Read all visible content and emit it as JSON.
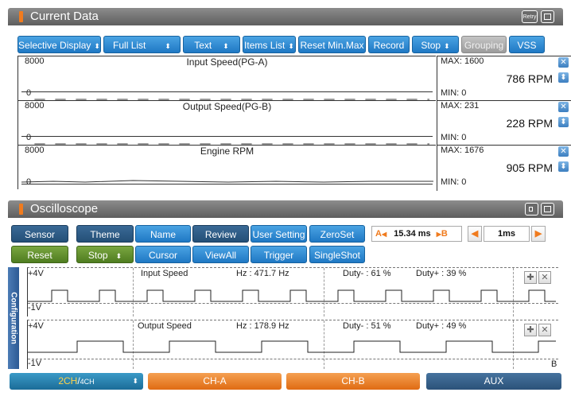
{
  "current_data": {
    "title": "Current Data",
    "retry_label": "Retry",
    "toolbar": {
      "selective_display": "Selective Display",
      "full_list": "Full List",
      "text": "Text",
      "items_list": "Items List",
      "reset_min_max": "Reset Min.Max",
      "record": "Record",
      "stop": "Stop",
      "grouping": "Grouping",
      "vss": "VSS"
    },
    "graphs": [
      {
        "title": "Input Speed(PG-A)",
        "ymax": "8000",
        "ymin": "0",
        "max": "MAX: 1600",
        "min": "MIN: 0",
        "value": "786 RPM"
      },
      {
        "title": "Output Speed(PG-B)",
        "ymax": "8000",
        "ymin": "0",
        "max": "MAX: 231",
        "min": "MIN: 0",
        "value": "228 RPM"
      },
      {
        "title": "Engine RPM",
        "ymax": "8000",
        "ymin": "0",
        "max": "MAX: 1676",
        "min": "MIN: 0",
        "value": "905 RPM"
      }
    ]
  },
  "oscilloscope": {
    "title": "Oscilloscope",
    "row1": {
      "sensor": "Sensor",
      "theme": "Theme",
      "name": "Name",
      "review": "Review",
      "user_setting": "User Setting",
      "zeroset": "ZeroSet"
    },
    "row2": {
      "reset": "Reset",
      "stop": "Stop",
      "cursor": "Cursor",
      "viewall": "ViewAll",
      "trigger": "Trigger",
      "singleshot": "SingleShot"
    },
    "cursor_a": "A",
    "cursor_time": "15.34 ms",
    "cursor_b": "B",
    "timebase": "1ms",
    "configuration_label": "Configuration",
    "channels": [
      {
        "plus": "+4V",
        "minus": "-1V",
        "name": "Input Speed",
        "hz": "Hz : 471.7 Hz",
        "duty_minus": "Duty- : 61 %",
        "duty_plus": "Duty+ : 39 %"
      },
      {
        "plus": "+4V",
        "minus": "-1V",
        "name": "Output Speed",
        "hz": "Hz : 178.9 Hz",
        "duty_minus": "Duty- : 51 %",
        "duty_plus": "Duty+ : 49 %",
        "marker": "B"
      }
    ]
  },
  "bottom_tabs": {
    "ch_mode_active": "2CH",
    "ch_mode_sep": "/",
    "ch_mode_other": "4CH",
    "ch_a": "CH-A",
    "ch_b": "CH-B",
    "aux": "AUX"
  },
  "colors": {
    "accent_blue": "#1f78c4",
    "accent_orange": "#f07b1e",
    "green": "#4f7d20",
    "header_gray": "#6a6a6a"
  },
  "icons": [
    "retry-icon",
    "window-icon",
    "close-icon",
    "sort-icon",
    "plus-icon",
    "maximize-icon",
    "arrow-left-icon",
    "arrow-right-icon"
  ]
}
